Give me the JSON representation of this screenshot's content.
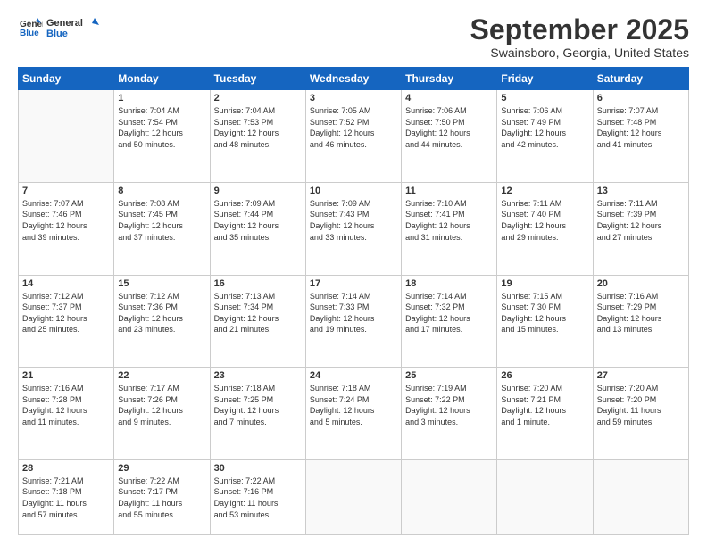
{
  "logo": {
    "general": "General",
    "blue": "Blue"
  },
  "header": {
    "title": "September 2025",
    "location": "Swainsboro, Georgia, United States"
  },
  "weekdays": [
    "Sunday",
    "Monday",
    "Tuesday",
    "Wednesday",
    "Thursday",
    "Friday",
    "Saturday"
  ],
  "weeks": [
    [
      {
        "day": "",
        "info": ""
      },
      {
        "day": "1",
        "info": "Sunrise: 7:04 AM\nSunset: 7:54 PM\nDaylight: 12 hours\nand 50 minutes."
      },
      {
        "day": "2",
        "info": "Sunrise: 7:04 AM\nSunset: 7:53 PM\nDaylight: 12 hours\nand 48 minutes."
      },
      {
        "day": "3",
        "info": "Sunrise: 7:05 AM\nSunset: 7:52 PM\nDaylight: 12 hours\nand 46 minutes."
      },
      {
        "day": "4",
        "info": "Sunrise: 7:06 AM\nSunset: 7:50 PM\nDaylight: 12 hours\nand 44 minutes."
      },
      {
        "day": "5",
        "info": "Sunrise: 7:06 AM\nSunset: 7:49 PM\nDaylight: 12 hours\nand 42 minutes."
      },
      {
        "day": "6",
        "info": "Sunrise: 7:07 AM\nSunset: 7:48 PM\nDaylight: 12 hours\nand 41 minutes."
      }
    ],
    [
      {
        "day": "7",
        "info": "Sunrise: 7:07 AM\nSunset: 7:46 PM\nDaylight: 12 hours\nand 39 minutes."
      },
      {
        "day": "8",
        "info": "Sunrise: 7:08 AM\nSunset: 7:45 PM\nDaylight: 12 hours\nand 37 minutes."
      },
      {
        "day": "9",
        "info": "Sunrise: 7:09 AM\nSunset: 7:44 PM\nDaylight: 12 hours\nand 35 minutes."
      },
      {
        "day": "10",
        "info": "Sunrise: 7:09 AM\nSunset: 7:43 PM\nDaylight: 12 hours\nand 33 minutes."
      },
      {
        "day": "11",
        "info": "Sunrise: 7:10 AM\nSunset: 7:41 PM\nDaylight: 12 hours\nand 31 minutes."
      },
      {
        "day": "12",
        "info": "Sunrise: 7:11 AM\nSunset: 7:40 PM\nDaylight: 12 hours\nand 29 minutes."
      },
      {
        "day": "13",
        "info": "Sunrise: 7:11 AM\nSunset: 7:39 PM\nDaylight: 12 hours\nand 27 minutes."
      }
    ],
    [
      {
        "day": "14",
        "info": "Sunrise: 7:12 AM\nSunset: 7:37 PM\nDaylight: 12 hours\nand 25 minutes."
      },
      {
        "day": "15",
        "info": "Sunrise: 7:12 AM\nSunset: 7:36 PM\nDaylight: 12 hours\nand 23 minutes."
      },
      {
        "day": "16",
        "info": "Sunrise: 7:13 AM\nSunset: 7:34 PM\nDaylight: 12 hours\nand 21 minutes."
      },
      {
        "day": "17",
        "info": "Sunrise: 7:14 AM\nSunset: 7:33 PM\nDaylight: 12 hours\nand 19 minutes."
      },
      {
        "day": "18",
        "info": "Sunrise: 7:14 AM\nSunset: 7:32 PM\nDaylight: 12 hours\nand 17 minutes."
      },
      {
        "day": "19",
        "info": "Sunrise: 7:15 AM\nSunset: 7:30 PM\nDaylight: 12 hours\nand 15 minutes."
      },
      {
        "day": "20",
        "info": "Sunrise: 7:16 AM\nSunset: 7:29 PM\nDaylight: 12 hours\nand 13 minutes."
      }
    ],
    [
      {
        "day": "21",
        "info": "Sunrise: 7:16 AM\nSunset: 7:28 PM\nDaylight: 12 hours\nand 11 minutes."
      },
      {
        "day": "22",
        "info": "Sunrise: 7:17 AM\nSunset: 7:26 PM\nDaylight: 12 hours\nand 9 minutes."
      },
      {
        "day": "23",
        "info": "Sunrise: 7:18 AM\nSunset: 7:25 PM\nDaylight: 12 hours\nand 7 minutes."
      },
      {
        "day": "24",
        "info": "Sunrise: 7:18 AM\nSunset: 7:24 PM\nDaylight: 12 hours\nand 5 minutes."
      },
      {
        "day": "25",
        "info": "Sunrise: 7:19 AM\nSunset: 7:22 PM\nDaylight: 12 hours\nand 3 minutes."
      },
      {
        "day": "26",
        "info": "Sunrise: 7:20 AM\nSunset: 7:21 PM\nDaylight: 12 hours\nand 1 minute."
      },
      {
        "day": "27",
        "info": "Sunrise: 7:20 AM\nSunset: 7:20 PM\nDaylight: 11 hours\nand 59 minutes."
      }
    ],
    [
      {
        "day": "28",
        "info": "Sunrise: 7:21 AM\nSunset: 7:18 PM\nDaylight: 11 hours\nand 57 minutes."
      },
      {
        "day": "29",
        "info": "Sunrise: 7:22 AM\nSunset: 7:17 PM\nDaylight: 11 hours\nand 55 minutes."
      },
      {
        "day": "30",
        "info": "Sunrise: 7:22 AM\nSunset: 7:16 PM\nDaylight: 11 hours\nand 53 minutes."
      },
      {
        "day": "",
        "info": ""
      },
      {
        "day": "",
        "info": ""
      },
      {
        "day": "",
        "info": ""
      },
      {
        "day": "",
        "info": ""
      }
    ]
  ]
}
